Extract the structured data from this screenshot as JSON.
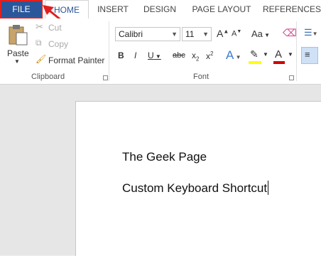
{
  "tabs": {
    "file": "FILE",
    "home": "HOME",
    "insert": "INSERT",
    "design": "DESIGN",
    "page_layout": "PAGE LAYOUT",
    "references": "REFERENCES"
  },
  "clipboard": {
    "paste": "Paste",
    "cut": "Cut",
    "copy": "Copy",
    "format_painter": "Format Painter",
    "label": "Clipboard"
  },
  "font": {
    "family": "Calibri",
    "size": "11",
    "grow": "A",
    "shrink": "A",
    "change_case": "Aa",
    "bold": "B",
    "italic": "I",
    "underline": "U",
    "strikethrough": "abc",
    "subscript": "x",
    "superscript": "x",
    "text_effects": "A",
    "font_color": "A",
    "label": "Font"
  },
  "document": {
    "line1": "The Geek Page",
    "line2": "Custom Keyboard Shortcut"
  },
  "colors": {
    "file_tab": "#2b579a",
    "annotation": "#e02020",
    "highlight": "#ffff00",
    "font_color": "#d00000"
  }
}
